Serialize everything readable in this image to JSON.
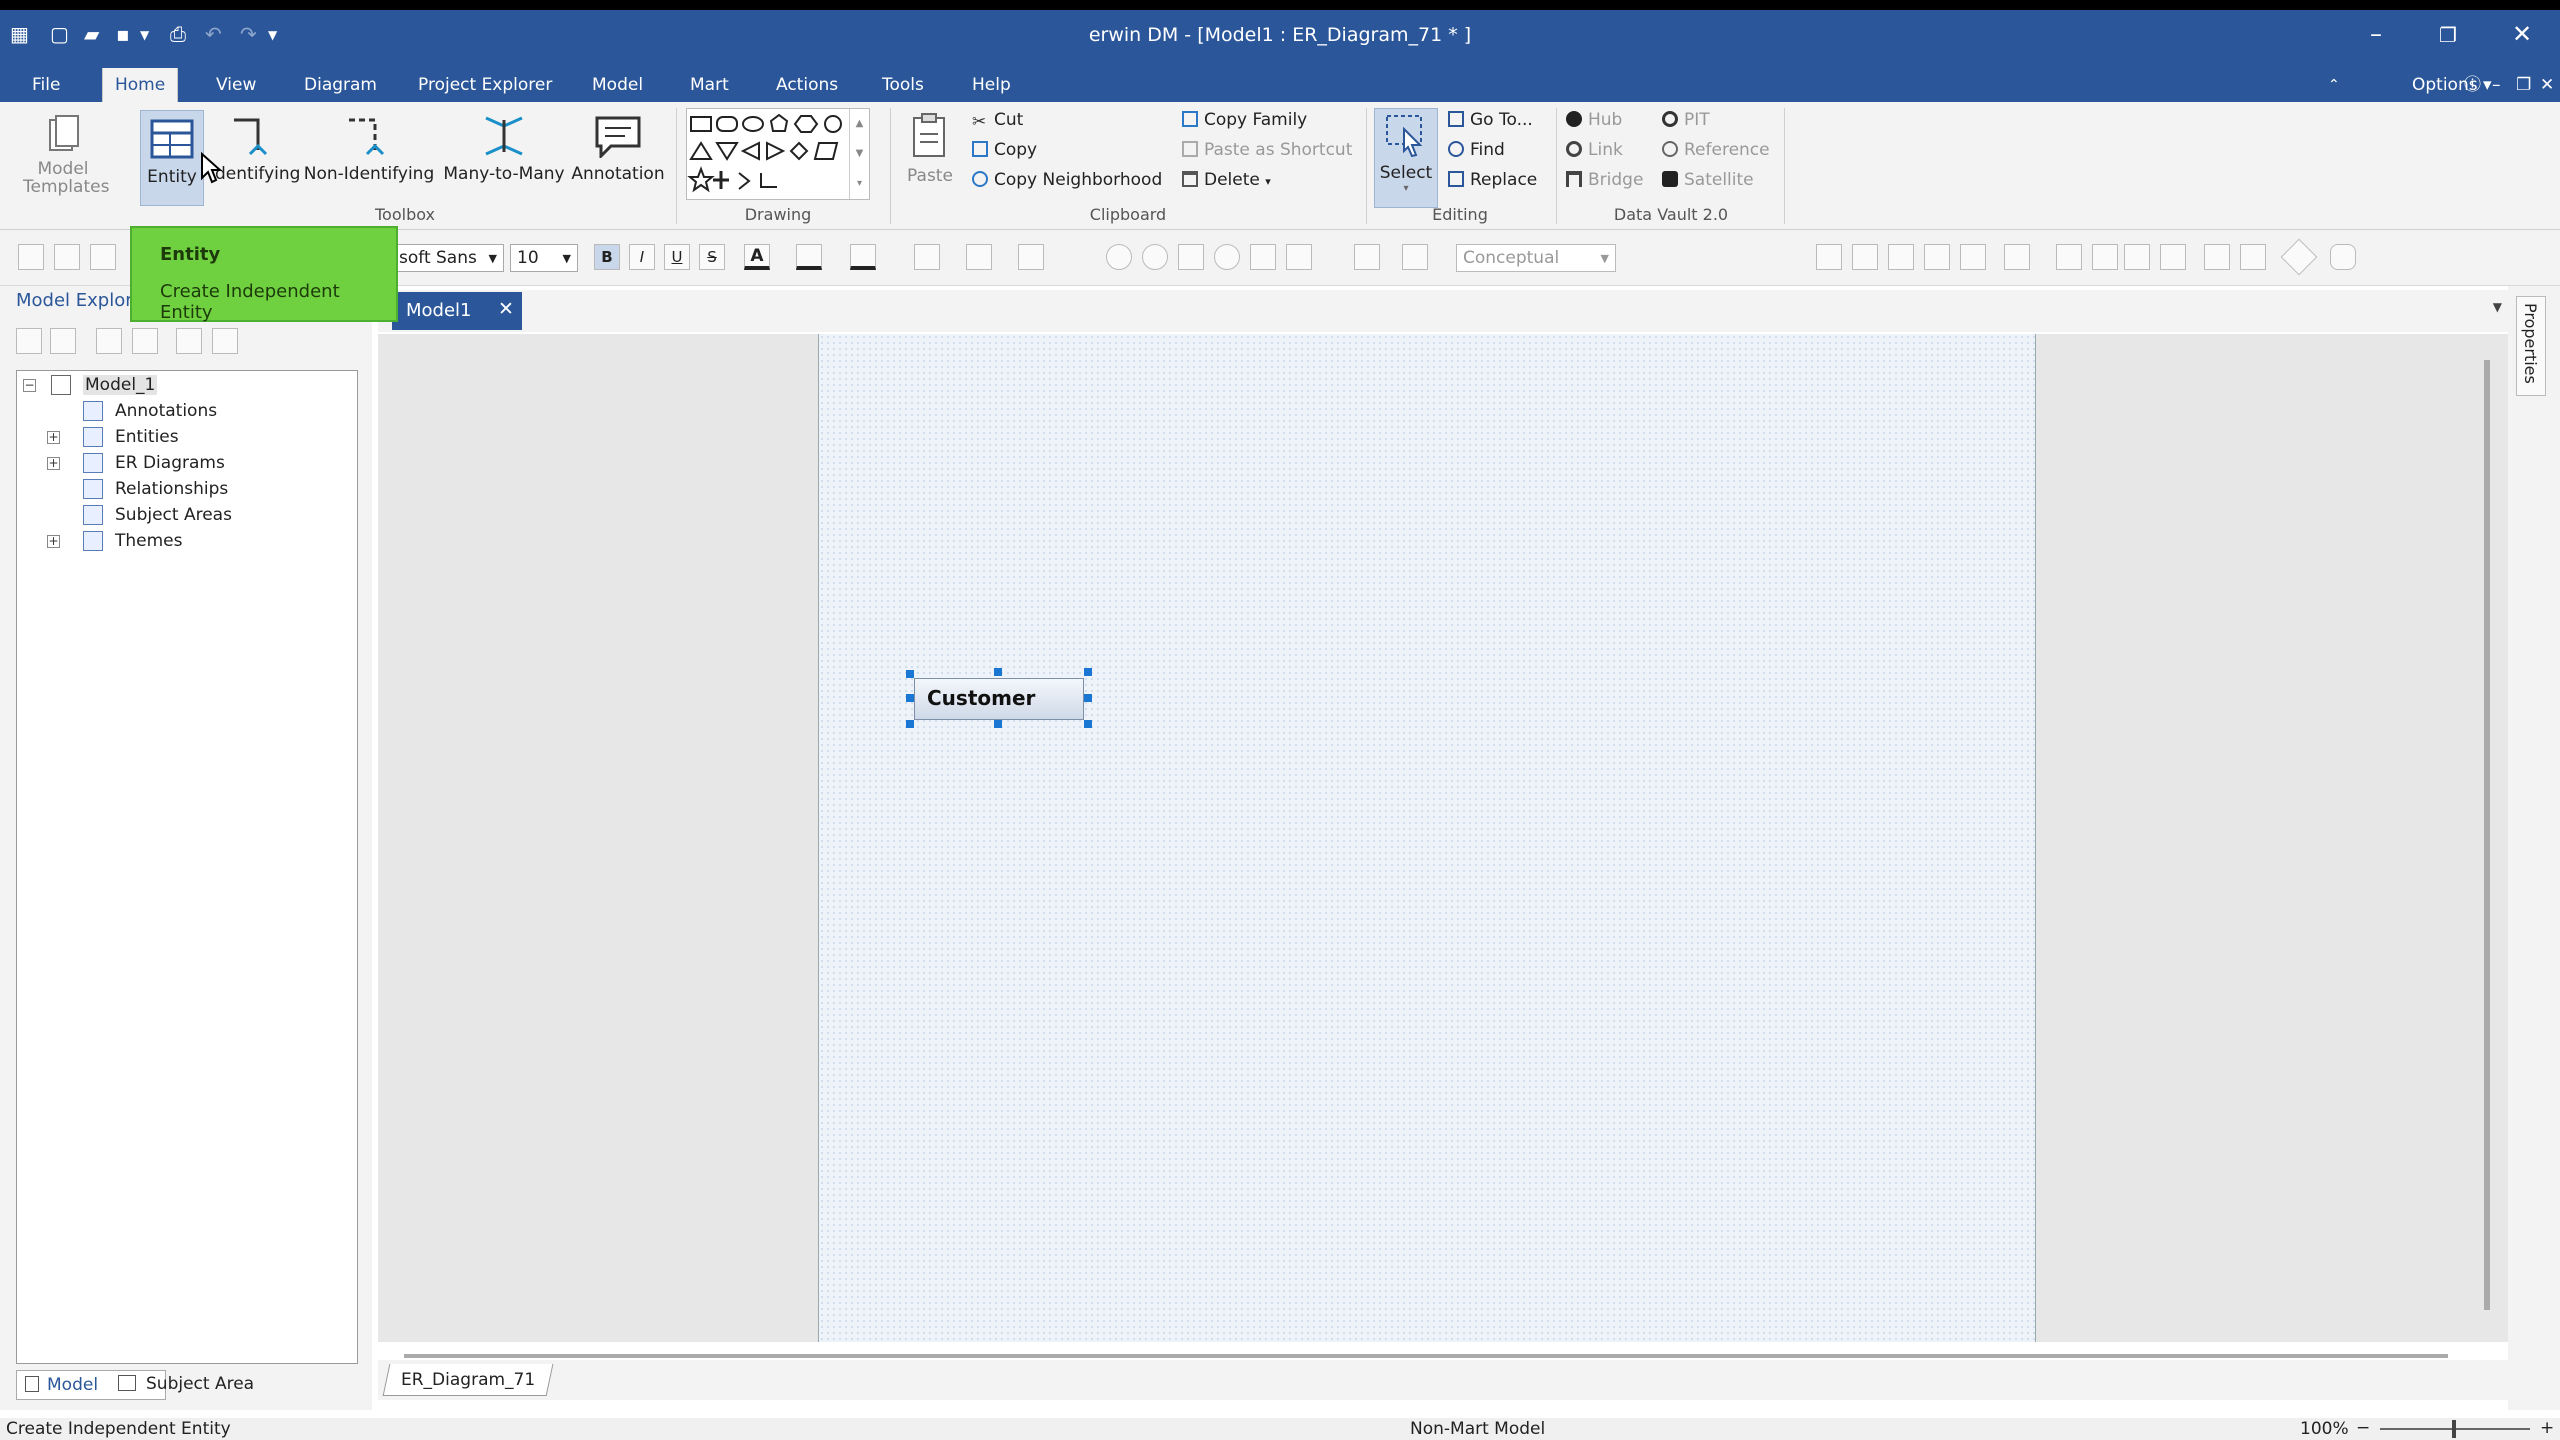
{
  "window": {
    "title": "erwin DM - [Model1 : ER_Diagram_71 * ]"
  },
  "menu": [
    "File",
    "Home",
    "View",
    "Diagram",
    "Project Explorer",
    "Model",
    "Mart",
    "Actions",
    "Tools",
    "Help"
  ],
  "menu_right": {
    "options": "Options"
  },
  "ribbon": {
    "model_templates": "Model Templates",
    "toolbox": [
      "Entity",
      "Identifying",
      "Non-Identifying",
      "Many-to-Many",
      "Annotation"
    ],
    "toolbox_label": "Toolbox",
    "drawing_label": "Drawing",
    "paste": "Paste",
    "clipboard": [
      "Cut",
      "Copy",
      "Copy Neighborhood",
      "Copy Family",
      "Paste as Shortcut",
      "Delete"
    ],
    "clipboard_label": "Clipboard",
    "select": "Select",
    "editing": [
      "Go To...",
      "Find",
      "Replace"
    ],
    "editing_label": "Editing",
    "datavault": [
      "Hub",
      "Link",
      "Bridge",
      "PIT",
      "Reference",
      "Satellite"
    ],
    "datavault_label": "Data Vault 2.0"
  },
  "format": {
    "font": "soft Sans",
    "size": "10",
    "notation": "Conceptual"
  },
  "tooltip": {
    "title": "Entity",
    "desc": "Create Independent Entity"
  },
  "explorer": {
    "title": "Model Explore",
    "root": "Model_1",
    "items": [
      "Annotations",
      "Entities",
      "ER Diagrams",
      "Relationships",
      "Subject Areas",
      "Themes"
    ],
    "tabs": [
      "Model",
      "Subject Area"
    ]
  },
  "document": {
    "tab": "Model1",
    "diagram_tab": "ER_Diagram_71"
  },
  "diagram": {
    "entity": "Customer"
  },
  "right_panel": "Properties",
  "status": {
    "left": "Create Independent Entity",
    "center": "Non-Mart Model",
    "zoom": "100%"
  }
}
